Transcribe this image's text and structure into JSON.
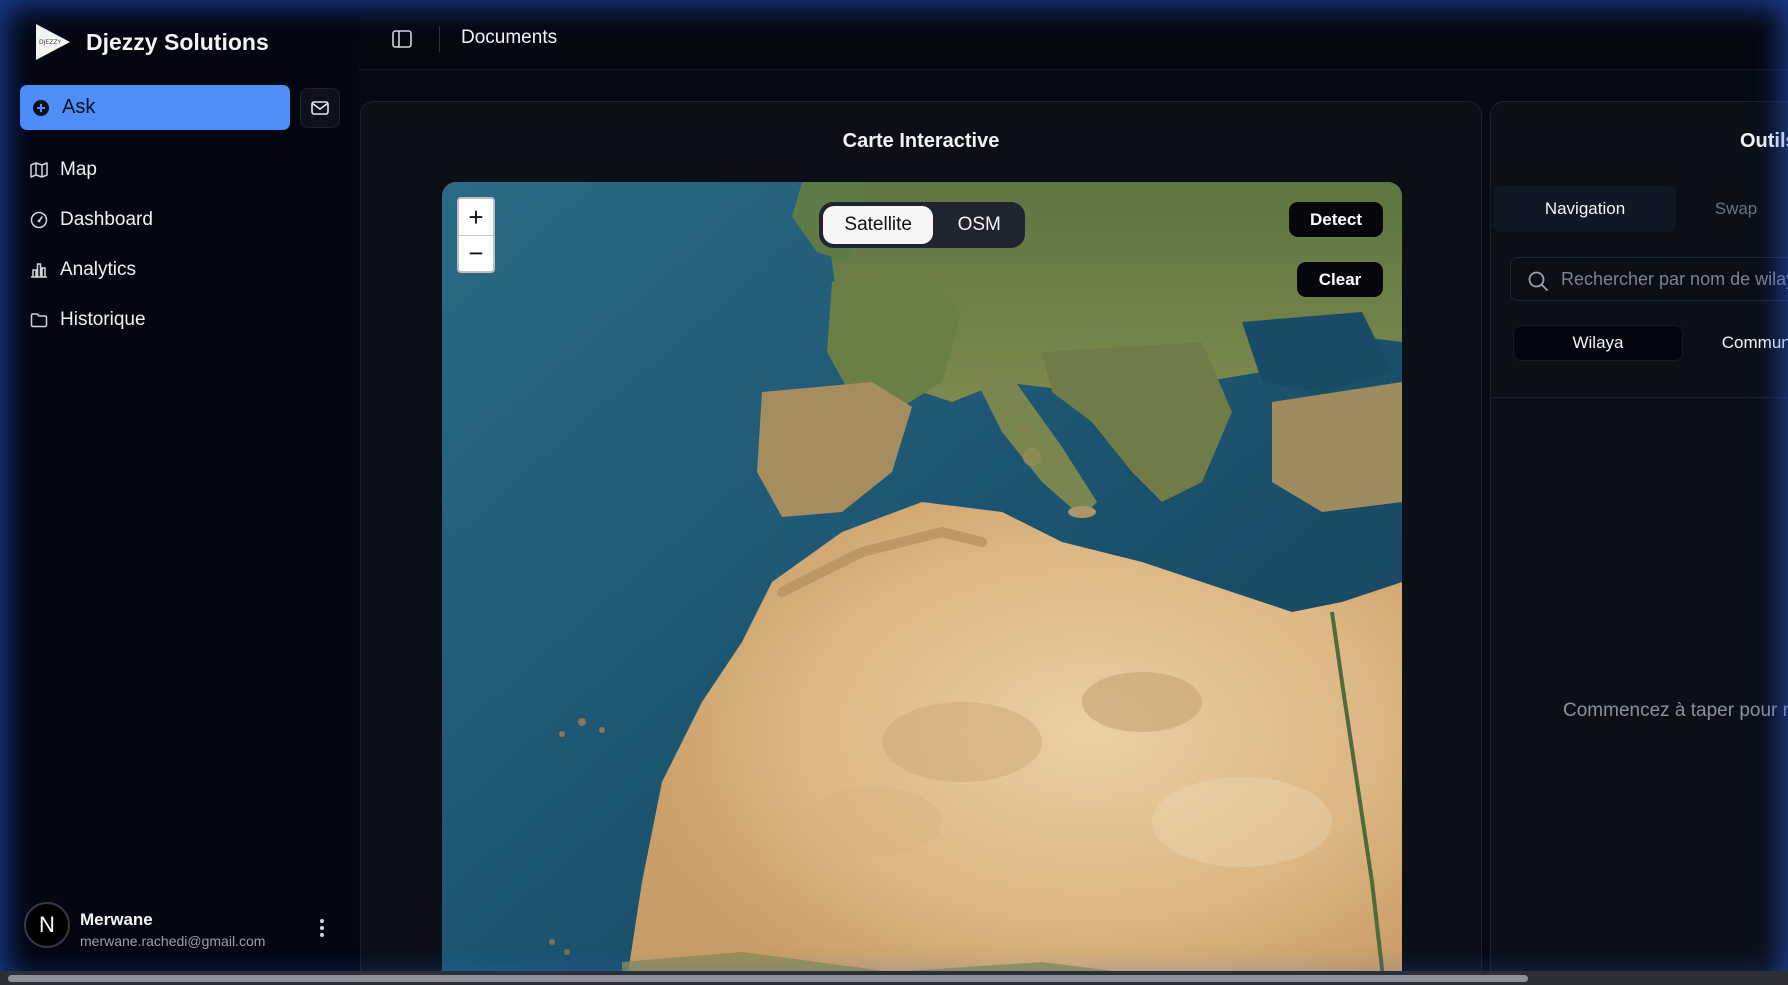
{
  "app": {
    "name": "Djezzy Solutions",
    "logo_text": "DJEZZY"
  },
  "sidebar": {
    "ask_label": "Ask",
    "items": [
      {
        "label": "Map",
        "icon": "map-icon"
      },
      {
        "label": "Dashboard",
        "icon": "gauge-icon"
      },
      {
        "label": "Analytics",
        "icon": "bar-chart-icon"
      },
      {
        "label": "Historique",
        "icon": "folder-icon"
      }
    ]
  },
  "user": {
    "initial": "N",
    "name": "Merwane",
    "email": "merwane.rachedi@gmail.com"
  },
  "topbar": {
    "title": "Documents"
  },
  "map_card": {
    "title": "Carte Interactive",
    "zoom_in": "+",
    "zoom_out": "−",
    "layers": {
      "active": "Satellite",
      "inactive": "OSM"
    },
    "detect_label": "Detect",
    "clear_label": "Clear"
  },
  "panel": {
    "title": "Outils",
    "tabs": [
      "Navigation",
      "Swap"
    ],
    "search_placeholder": "Rechercher par nom de wilaya",
    "sub_tabs": [
      "Wilaya",
      "Commune"
    ],
    "empty_text": "Commencez à taper pour rechercher"
  },
  "colors": {
    "accent": "#4f8ef7",
    "background": "#03050c",
    "card": "#0b0f18",
    "glow": "#2d69ff"
  }
}
